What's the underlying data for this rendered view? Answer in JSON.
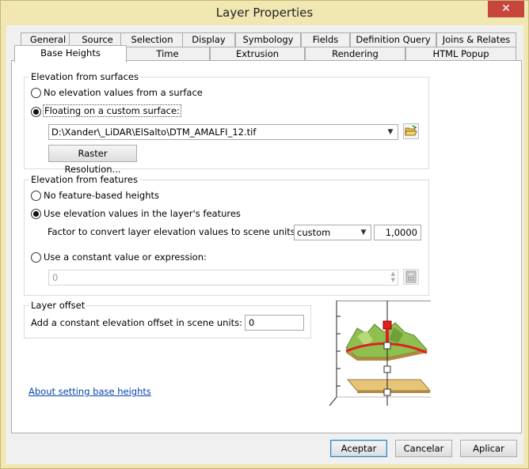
{
  "window": {
    "title": "Layer Properties",
    "close_glyph": "✕"
  },
  "tabs_row1": [
    {
      "label": "General"
    },
    {
      "label": "Source"
    },
    {
      "label": "Selection"
    },
    {
      "label": "Display"
    },
    {
      "label": "Symbology"
    },
    {
      "label": "Fields"
    },
    {
      "label": "Definition Query"
    },
    {
      "label": "Joins & Relates"
    }
  ],
  "tabs_row2": [
    {
      "label": "Base Heights"
    },
    {
      "label": "Time"
    },
    {
      "label": "Extrusion"
    },
    {
      "label": "Rendering"
    },
    {
      "label": "HTML Popup"
    }
  ],
  "surfaces": {
    "title": "Elevation from surfaces",
    "no_elevation_label": "No elevation values from a surface",
    "floating_label": "Floating on a custom surface:",
    "surface_path": "D:\\Xander\\_LiDAR\\ElSalto\\DTM_AMALFI_12.tif",
    "raster_resolution_button": "Raster Resolution..."
  },
  "features": {
    "title": "Elevation from features",
    "no_feature_label": "No feature-based heights",
    "use_elevation_label": "Use elevation values in the layer's features",
    "factor_label": "Factor to convert layer elevation values to scene units:",
    "factor_unit": "custom",
    "factor_value": "1,0000",
    "constant_label": "Use a constant value or expression:",
    "constant_value": "0"
  },
  "offset": {
    "title": "Layer offset",
    "label": "Add a constant elevation offset in scene units:",
    "value": "0"
  },
  "help_link": "About setting base heights",
  "buttons": {
    "ok": "Aceptar",
    "cancel": "Cancelar",
    "apply": "Aplicar"
  },
  "colors": {
    "terrain": "#8fbf4f",
    "feature_line": "#e0201f",
    "base_plane": "#e6c478"
  }
}
